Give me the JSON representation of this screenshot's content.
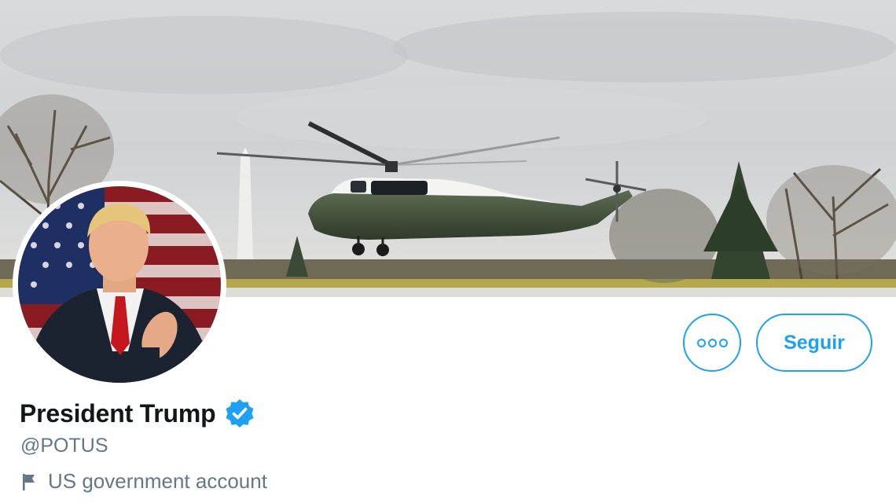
{
  "profile": {
    "display_name": "President Trump",
    "handle": "@POTUS",
    "account_label": "US government account",
    "verified": true
  },
  "actions": {
    "more_icon": "more-horizontal-icon",
    "follow_label": "Seguir"
  },
  "icons": {
    "verified": "verified-badge-icon",
    "label": "flag-icon"
  },
  "colors": {
    "accent": "#1da1f2",
    "name": "#14171a",
    "secondary": "#657786"
  }
}
